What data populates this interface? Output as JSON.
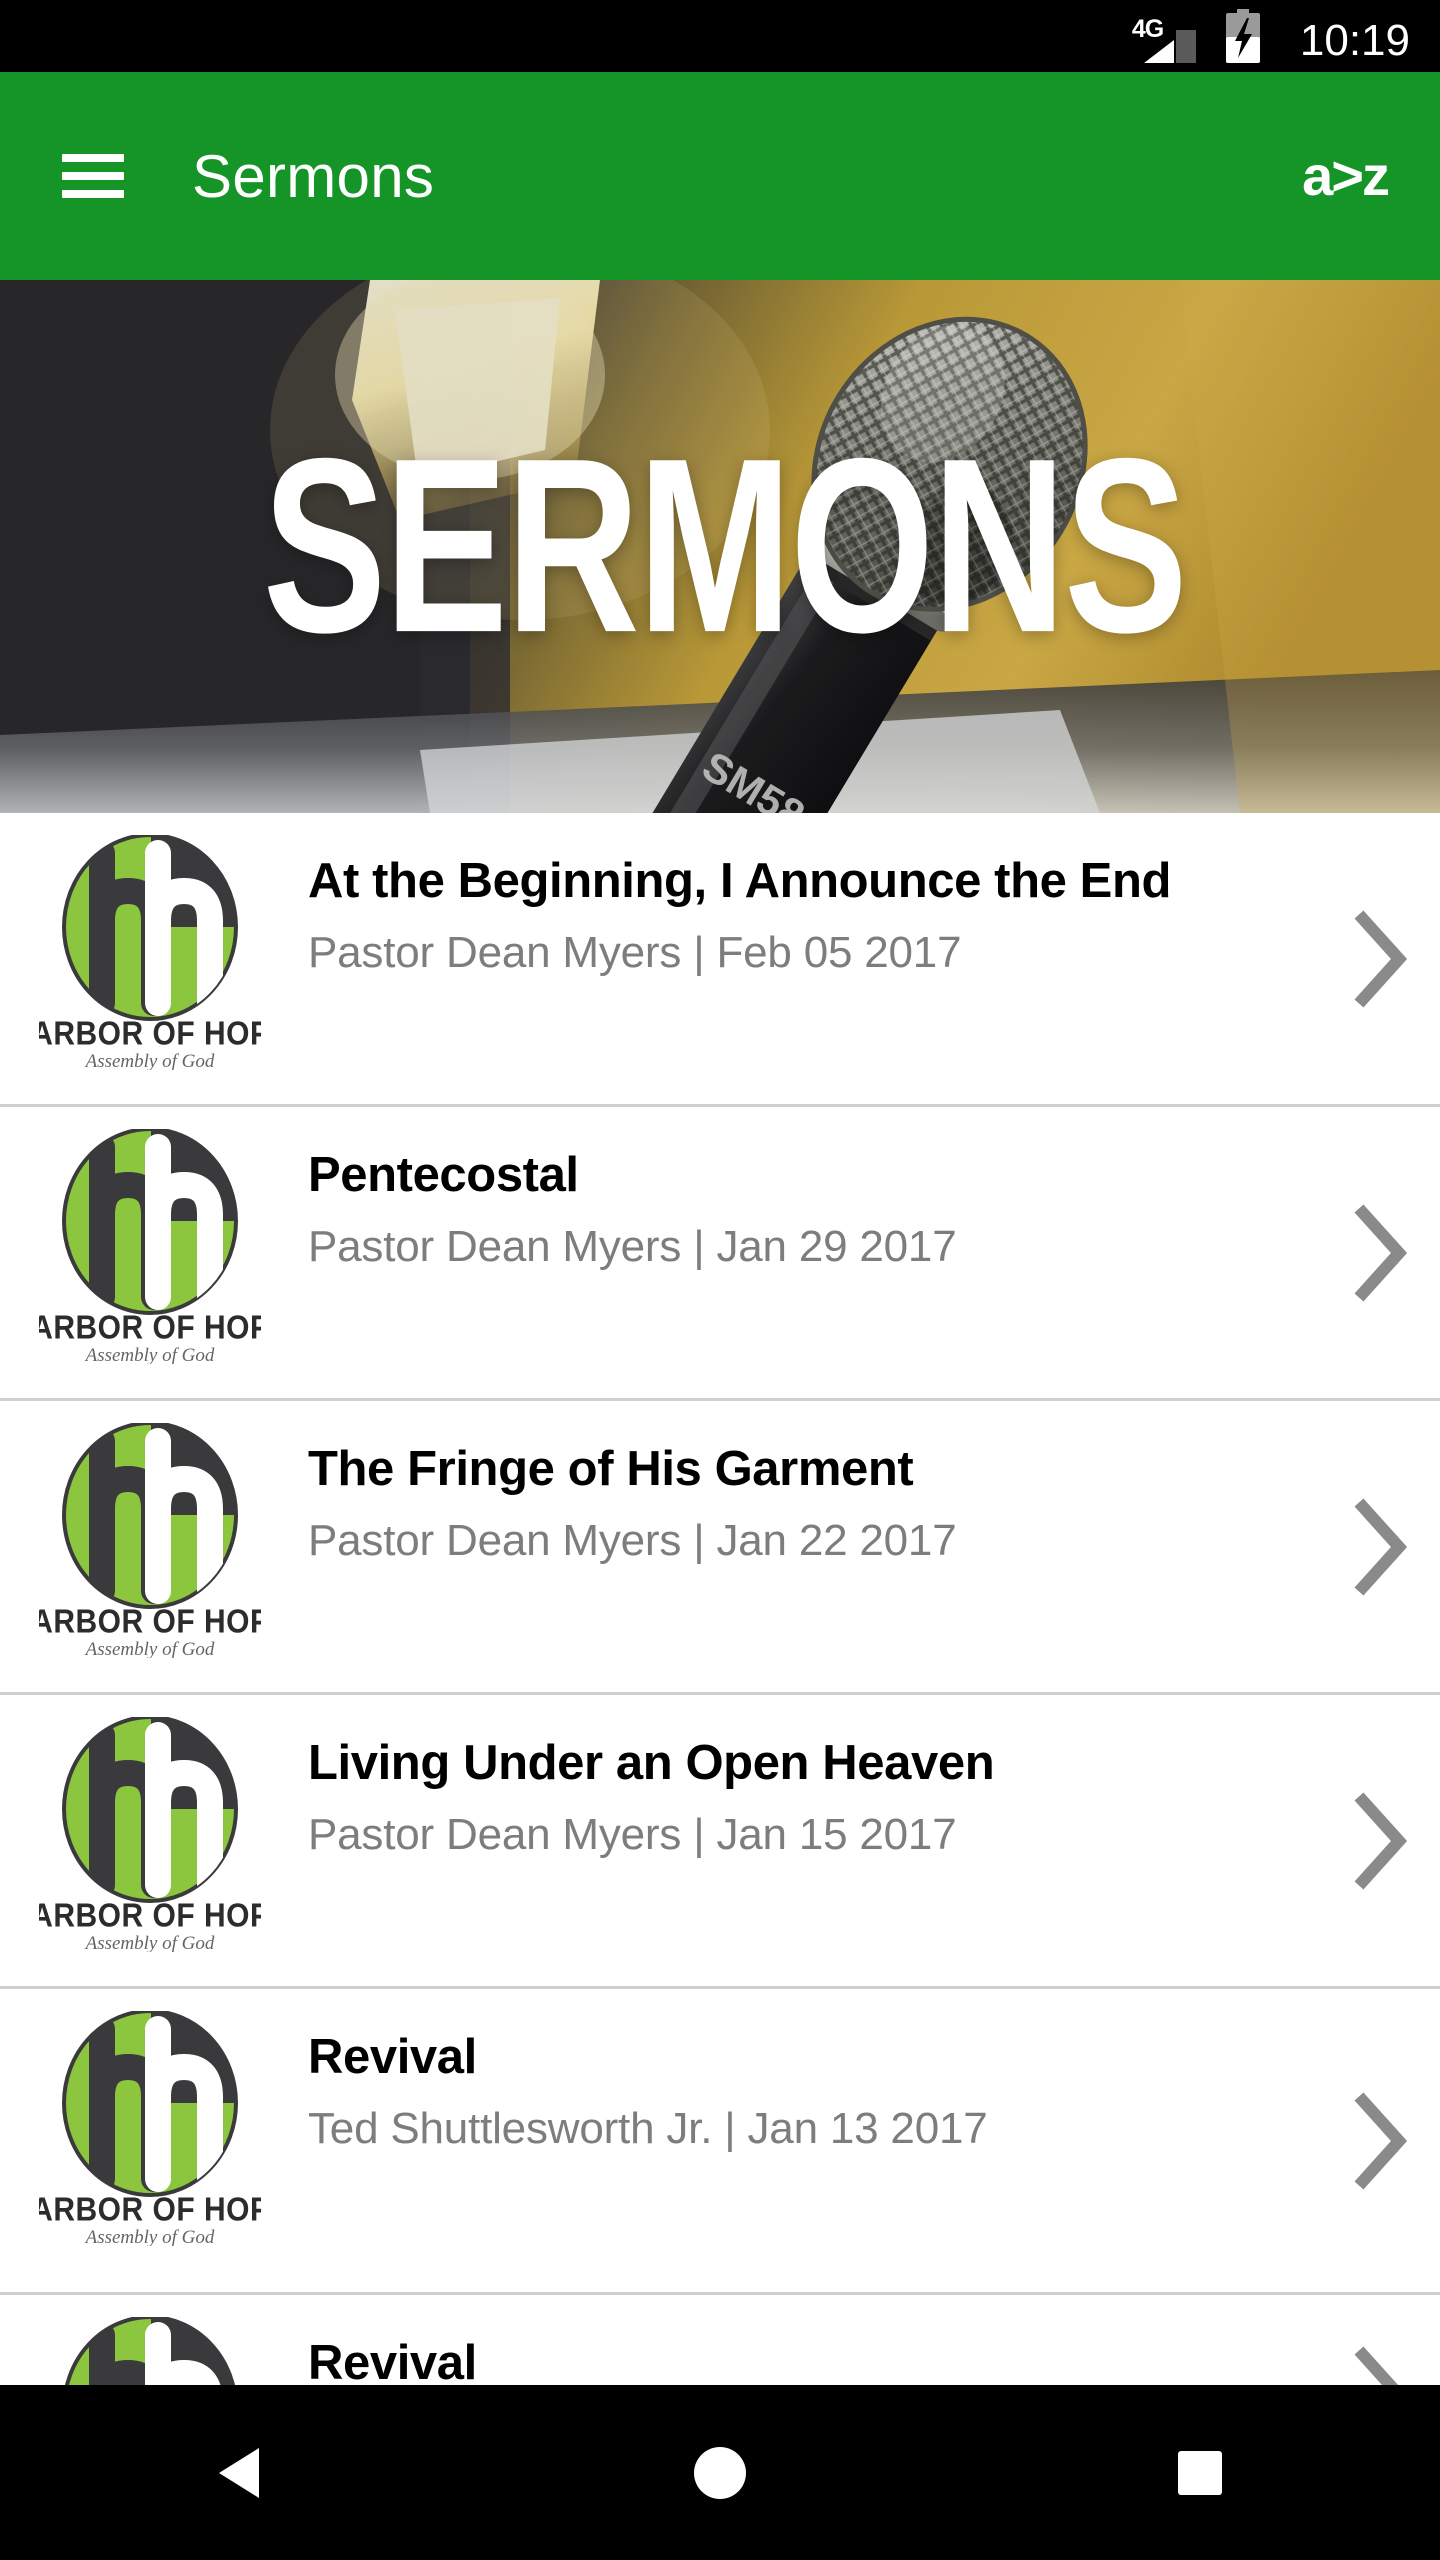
{
  "status_bar": {
    "network": "4G",
    "time": "10:19",
    "signal_icon": "signal-bars-icon",
    "battery_icon": "battery-charging-icon"
  },
  "app_bar": {
    "menu_icon": "hamburger-menu-icon",
    "title": "Sermons",
    "sort_label": "a>z",
    "sort_icon": "sort-alphabetical-icon",
    "background_color": "#159527"
  },
  "hero": {
    "headline": "SERMONS",
    "image_description": "shure-sm58-microphone-photo"
  },
  "logo": {
    "name": "Harbor of Hope",
    "wordmark": "HARBOR OF HOPE",
    "subtitle": "Assembly of God",
    "monogram": "hh",
    "green": "#8cc63e",
    "charcoal": "#3a3a3c"
  },
  "list": {
    "items": [
      {
        "title": "At the Beginning, I Announce the End",
        "meta": "Pastor Dean Myers | Feb 05 2017",
        "speaker": "Pastor Dean Myers",
        "date": "Feb 05 2017"
      },
      {
        "title": "Pentecostal",
        "meta": "Pastor Dean Myers | Jan 29 2017",
        "speaker": "Pastor Dean Myers",
        "date": "Jan 29 2017"
      },
      {
        "title": "The Fringe of His Garment",
        "meta": "Pastor Dean Myers | Jan 22 2017",
        "speaker": "Pastor Dean Myers",
        "date": "Jan 22 2017"
      },
      {
        "title": "Living Under an Open Heaven",
        "meta": "Pastor Dean Myers | Jan 15 2017",
        "speaker": "Pastor Dean Myers",
        "date": "Jan 15 2017"
      },
      {
        "title": "Revival",
        "meta": "Ted Shuttlesworth Jr. | Jan 13 2017",
        "speaker": "Ted Shuttlesworth Jr.",
        "date": "Jan 13 2017"
      },
      {
        "title": "Revival",
        "meta": "",
        "speaker": "",
        "date": ""
      }
    ],
    "chevron_icon": "chevron-right-icon",
    "divider_color": "#cfcfcf"
  },
  "nav_bar": {
    "back_icon": "back-triangle-icon",
    "home_icon": "home-circle-icon",
    "recents_icon": "recents-square-icon"
  }
}
